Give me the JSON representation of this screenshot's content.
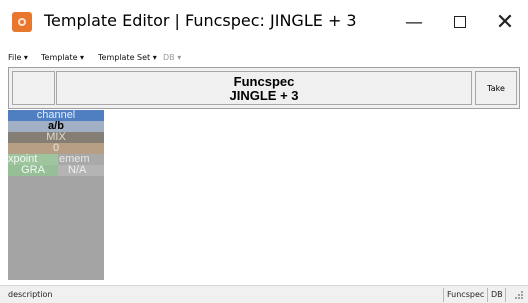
{
  "window": {
    "title": "Template Editor | Funcspec: JINGLE + 3",
    "minimize_glyph": "—",
    "close_glyph": "✕"
  },
  "menu": {
    "items": [
      {
        "label": "File ▾"
      },
      {
        "label": "Template ▾"
      },
      {
        "label": "Template Set ▾"
      },
      {
        "label": "DB ▾"
      }
    ]
  },
  "header": {
    "funcspec_line1": "Funcspec",
    "funcspec_line2": "JINGLE + 3",
    "take_label": "Take"
  },
  "channel_column": {
    "channel": "channel",
    "ab": "a/b",
    "mix": "MIX",
    "zero": "0",
    "xpoint": "xpoint",
    "emem": "emem",
    "gra": "GRA",
    "na": "N/A"
  },
  "statusbar": {
    "description": "description",
    "funcspec": "Funcspec",
    "db": "DB"
  },
  "colors": {
    "channel_bg": "#4f7fc1",
    "ab_bg": "#a2b0c5",
    "mix_bg": "#857e74",
    "zero_bg": "#b79f86",
    "xpoint_bg": "#9fc59f",
    "column_bg": "#a4a4a4",
    "app_icon": "#e8762c"
  },
  "icons": {
    "app": "app-icon",
    "minimize": "minimize-icon",
    "maximize": "maximize-icon",
    "close": "close-icon",
    "resize_grip": "resize-grip-icon"
  }
}
